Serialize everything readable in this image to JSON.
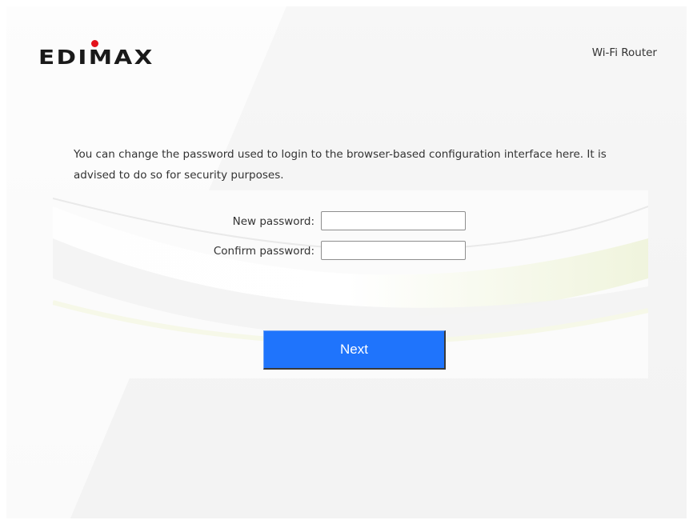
{
  "header": {
    "brand": "EDIMAX",
    "product_label": "Wi-Fi Router"
  },
  "main": {
    "intro_text": "You can change the password used to login to the browser-based configuration interface here. It is advised to do so for security purposes.",
    "fields": [
      {
        "label": "New password:",
        "value": "",
        "placeholder": ""
      },
      {
        "label": "Confirm password:",
        "value": "",
        "placeholder": ""
      }
    ],
    "next_label": "Next"
  },
  "colors": {
    "accent": "#1f74fc",
    "brand_dot": "#e3121b"
  },
  "icons": {
    "logo": "edimax-logo"
  }
}
